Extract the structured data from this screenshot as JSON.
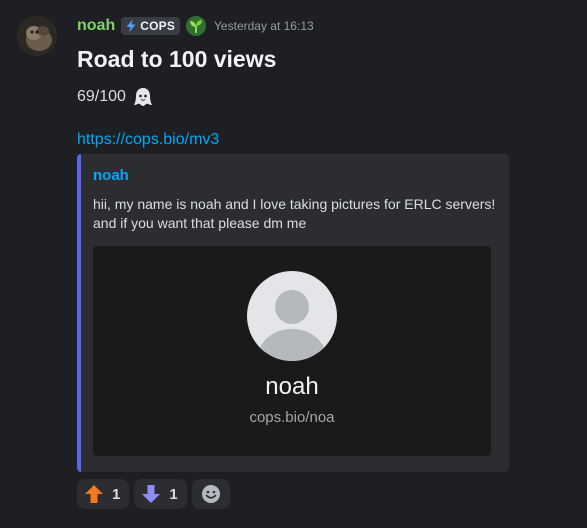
{
  "message": {
    "author": "noah",
    "tag": "COPS",
    "timestamp": "Yesterday at 16:13",
    "title": "Road to 100 views",
    "counter": "69/100",
    "link": "https://cops.bio/mv3"
  },
  "embed": {
    "author": "noah",
    "description_lines": [
      "hii, my name is noah and I love taking pictures for ERLC servers!",
      "and if you want that please dm me"
    ],
    "profile_name": "noah",
    "profile_url": "cops.bio/noa",
    "accent_color": "#5865f2"
  },
  "reactions": [
    {
      "icon": "arrow-up-icon",
      "count": "1"
    },
    {
      "icon": "arrow-down-icon",
      "count": "1"
    }
  ],
  "colors": {
    "background": "#1e1f22",
    "username": "#7fd36d",
    "link": "#00a8fc"
  }
}
